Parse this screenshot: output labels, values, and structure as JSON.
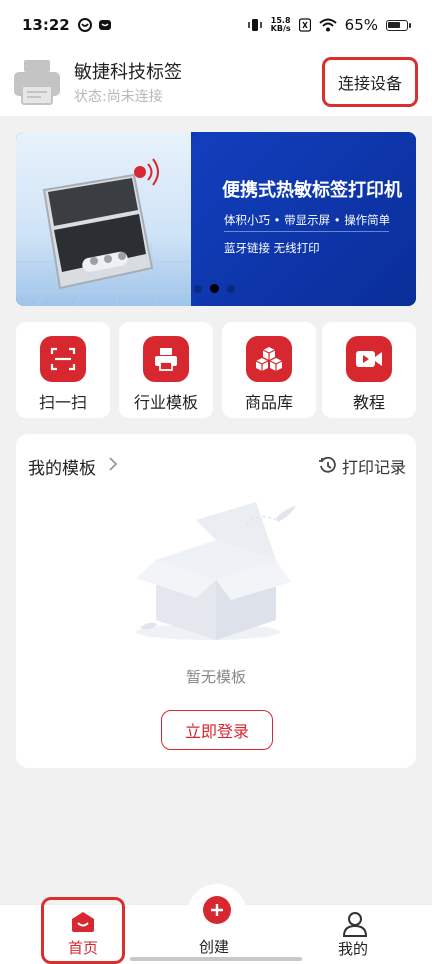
{
  "status_bar": {
    "time": "13:22",
    "net_speed_value": "15.8",
    "net_speed_unit": "KB/s",
    "battery": "65%"
  },
  "header": {
    "device_name": "敏捷科技标签",
    "device_status": "状态:尚未连接",
    "connect_label": "连接设备"
  },
  "banner": {
    "title": "便携式热敏标签打印机",
    "subtitle_1": "体积小巧 • 带显示屏 • 操作简单",
    "subtitle_2": "蓝牙链接 无线打印",
    "dots_total": 3,
    "active_dot": 2
  },
  "quick_menu": [
    {
      "label": "扫一扫",
      "icon": "scan-icon"
    },
    {
      "label": "行业模板",
      "icon": "printer-icon"
    },
    {
      "label": "商品库",
      "icon": "boxes-icon"
    },
    {
      "label": "教程",
      "icon": "video-icon"
    }
  ],
  "templates": {
    "title": "我的模板",
    "print_record_label": "打印记录",
    "empty_text": "暂无模板",
    "login_label": "立即登录"
  },
  "bottom_nav": {
    "home_label": "首页",
    "create_label": "创建",
    "me_label": "我的"
  },
  "colors": {
    "accent": "#d7282f",
    "highlight_outline": "#d9302f",
    "background": "#f1f1f1",
    "banner_blue": "#0d3bb3"
  }
}
